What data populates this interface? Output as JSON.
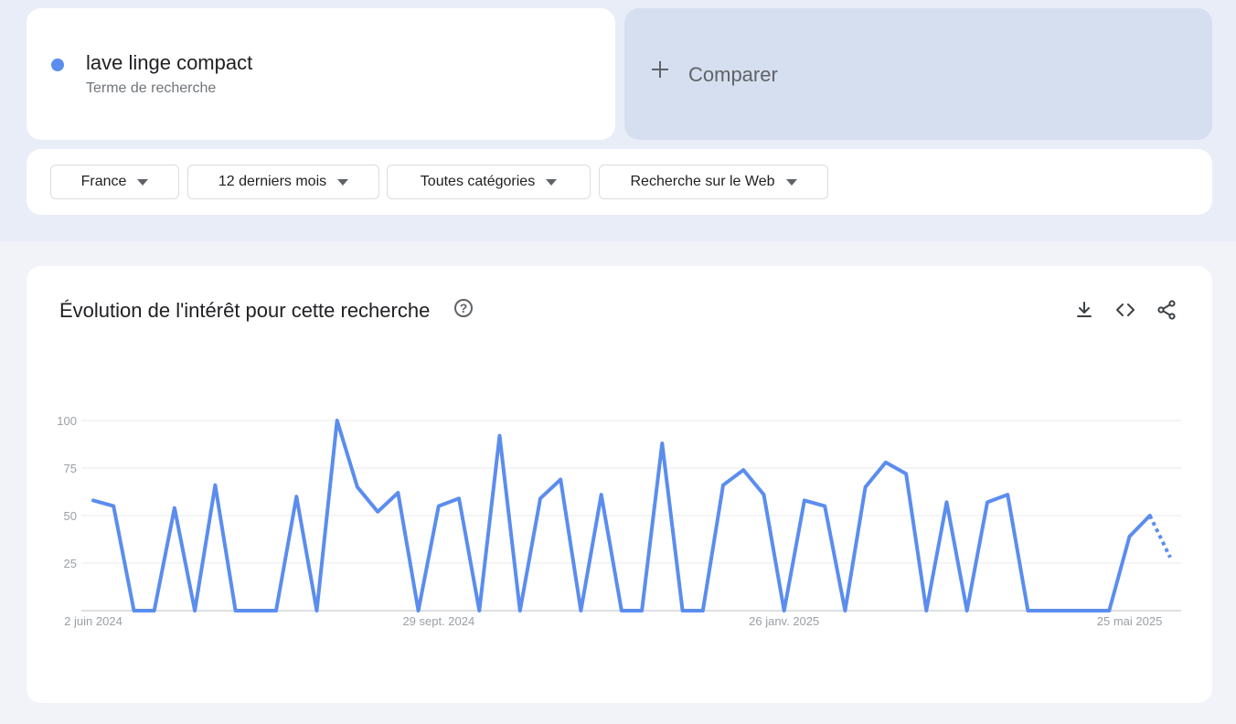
{
  "term": {
    "title": "lave linge compact",
    "subtitle": "Terme de recherche",
    "color": "#5b8def"
  },
  "compare": {
    "label": "Comparer",
    "icon": "plus-icon"
  },
  "filters": [
    {
      "label": "France"
    },
    {
      "label": "12 derniers mois"
    },
    {
      "label": "Toutes catégories"
    },
    {
      "label": "Recherche sur le Web"
    }
  ],
  "chart_card": {
    "title": "Évolution de l'intérêt pour cette recherche",
    "help_icon": "?",
    "tools": [
      "download-icon",
      "embed-code-icon",
      "share-icon"
    ]
  },
  "chart_data": {
    "type": "line",
    "title": "",
    "xlabel": "",
    "ylabel": "",
    "ylim": [
      0,
      100
    ],
    "yticks": [
      25,
      50,
      75,
      100
    ],
    "x_tick_labels": [
      "2 juin 2024",
      "29 sept. 2024",
      "26 janv. 2025",
      "25 mai 2025"
    ],
    "x_tick_indices": [
      0,
      17,
      34,
      51
    ],
    "grid": true,
    "series": [
      {
        "color": "#5b8def",
        "values": [
          58,
          55,
          0,
          0,
          54,
          0,
          66,
          0,
          0,
          0,
          60,
          0,
          100,
          65,
          52,
          62,
          0,
          55,
          59,
          0,
          92,
          0,
          59,
          69,
          0,
          61,
          0,
          0,
          88,
          0,
          0,
          66,
          74,
          61,
          0,
          58,
          55,
          0,
          65,
          78,
          72,
          0,
          57,
          0,
          57,
          61,
          0,
          0,
          0,
          0,
          0,
          39,
          50,
          28
        ],
        "partial_last_point": true
      }
    ]
  }
}
